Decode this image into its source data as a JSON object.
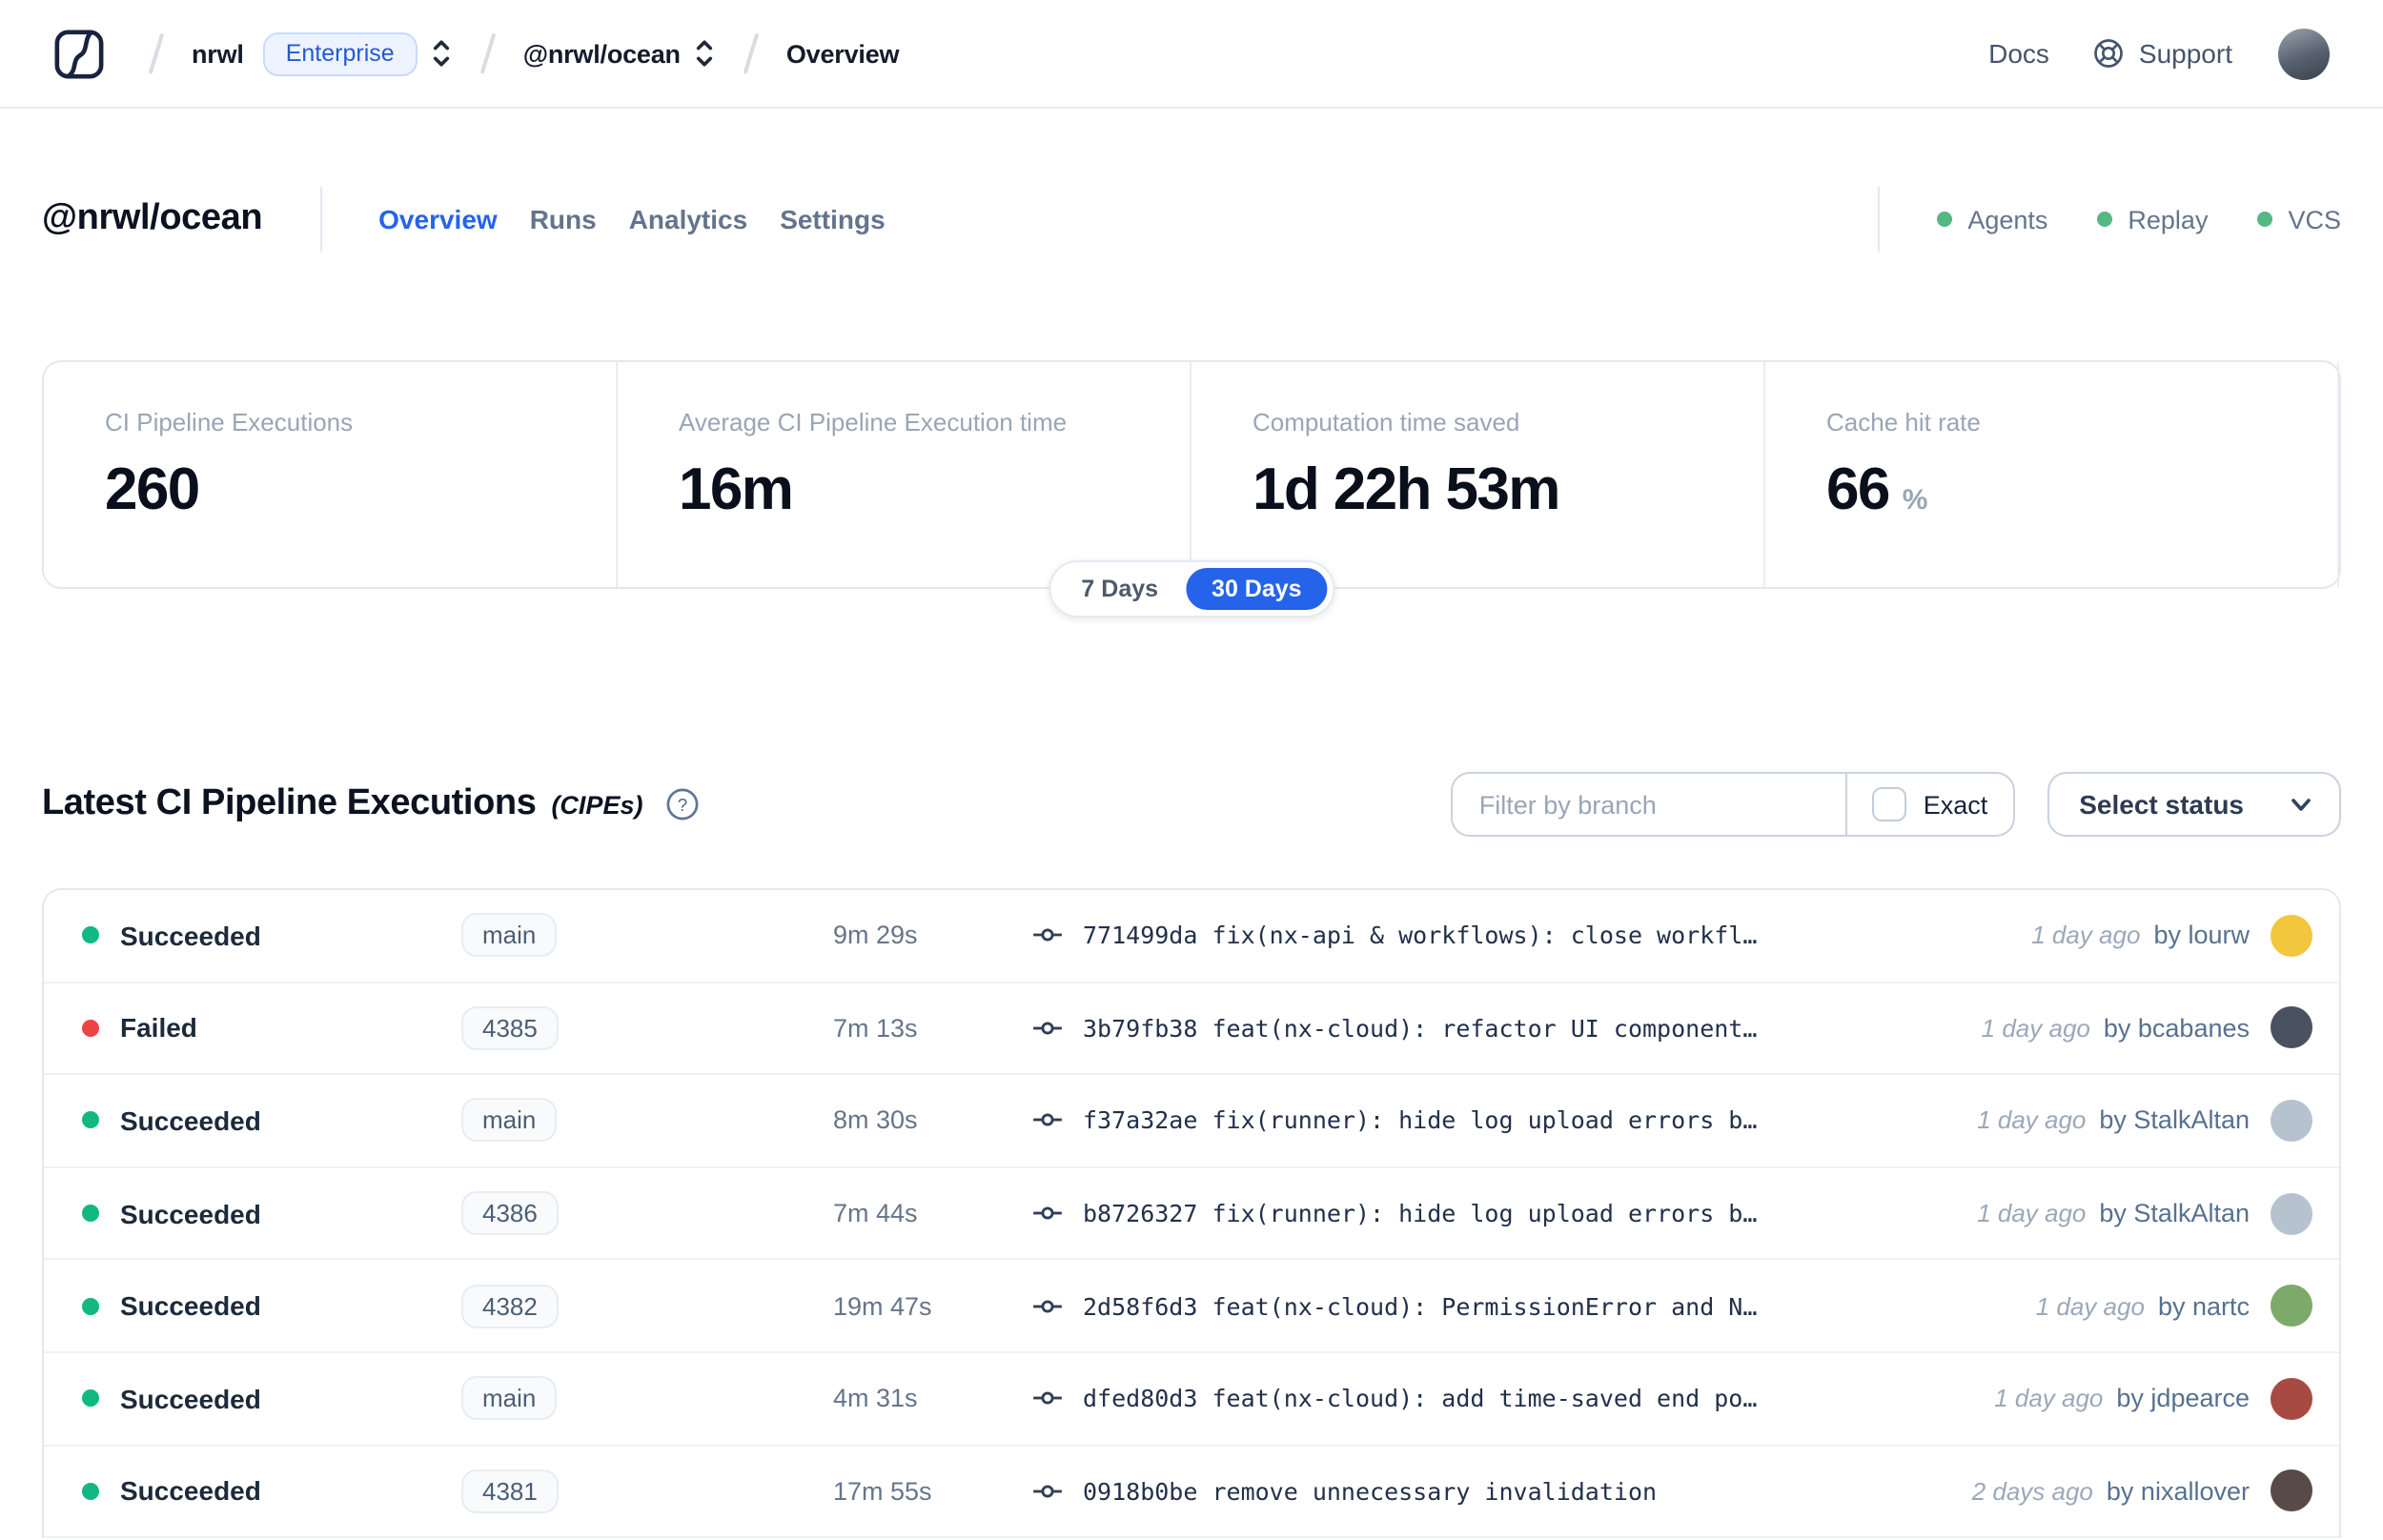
{
  "nav": {
    "breadcrumb": {
      "org": "nrwl",
      "org_badge": "Enterprise",
      "workspace": "@nrwl/ocean",
      "page": "Overview"
    },
    "links": {
      "docs": "Docs",
      "support": "Support"
    }
  },
  "header": {
    "title": "@nrwl/ocean",
    "tabs": [
      {
        "label": "Overview",
        "active": true
      },
      {
        "label": "Runs",
        "active": false
      },
      {
        "label": "Analytics",
        "active": false
      },
      {
        "label": "Settings",
        "active": false
      }
    ],
    "statuses": [
      {
        "label": "Agents"
      },
      {
        "label": "Replay"
      },
      {
        "label": "VCS"
      }
    ]
  },
  "stats": {
    "cards": [
      {
        "label": "CI Pipeline Executions",
        "value": "260",
        "suffix": ""
      },
      {
        "label": "Average CI Pipeline Execution time",
        "value": "16m",
        "suffix": ""
      },
      {
        "label": "Computation time saved",
        "value": "1d 22h 53m",
        "suffix": ""
      },
      {
        "label": "Cache hit rate",
        "value": "66",
        "suffix": "%"
      }
    ],
    "range_toggle": {
      "options": [
        "7 Days",
        "30 Days"
      ],
      "selected": "30 Days"
    }
  },
  "cipes": {
    "title": "Latest CI Pipeline Executions",
    "title_suffix": "(CIPEs)",
    "filter": {
      "placeholder": "Filter by branch",
      "exact_label": "Exact",
      "exact_checked": false,
      "status_label": "Select status"
    },
    "rows": [
      {
        "status": "Succeeded",
        "branch": "main",
        "duration": "9m 29s",
        "commit": "771499da fix(nx-api & workflows): close workfl…",
        "time_ago": "1 day ago",
        "author": "by lourw",
        "avatar_bg": "#f3c73d"
      },
      {
        "status": "Failed",
        "branch": "4385",
        "duration": "7m 13s",
        "commit": "3b79fb38 feat(nx-cloud): refactor UI component…",
        "time_ago": "1 day ago",
        "author": "by bcabanes",
        "avatar_bg": "#4a5261"
      },
      {
        "status": "Succeeded",
        "branch": "main",
        "duration": "8m 30s",
        "commit": "f37a32ae fix(runner): hide log upload errors b…",
        "time_ago": "1 day ago",
        "author": "by StalkAltan",
        "avatar_bg": "#b6c3cf"
      },
      {
        "status": "Succeeded",
        "branch": "4386",
        "duration": "7m 44s",
        "commit": "b8726327 fix(runner): hide log upload errors b…",
        "time_ago": "1 day ago",
        "author": "by StalkAltan",
        "avatar_bg": "#b6c3cf"
      },
      {
        "status": "Succeeded",
        "branch": "4382",
        "duration": "19m 47s",
        "commit": "2d58f6d3 feat(nx-cloud): PermissionError and N…",
        "time_ago": "1 day ago",
        "author": "by nartc",
        "avatar_bg": "#7da96a"
      },
      {
        "status": "Succeeded",
        "branch": "main",
        "duration": "4m 31s",
        "commit": "dfed80d3 feat(nx-cloud): add time-saved end po…",
        "time_ago": "1 day ago",
        "author": "by jdpearce",
        "avatar_bg": "#a84a44"
      },
      {
        "status": "Succeeded",
        "branch": "4381",
        "duration": "17m 55s",
        "commit": "0918b0be remove unnecessary invalidation",
        "time_ago": "2 days ago",
        "author": "by nixallover",
        "avatar_bg": "#574a47"
      }
    ]
  },
  "colors": {
    "accent_blue": "#2563eb",
    "succeeded_green": "#10b981",
    "failed_red": "#ef4444",
    "header_status_green": "#54b884",
    "enterprise_badge_blue": "#2458d6"
  }
}
